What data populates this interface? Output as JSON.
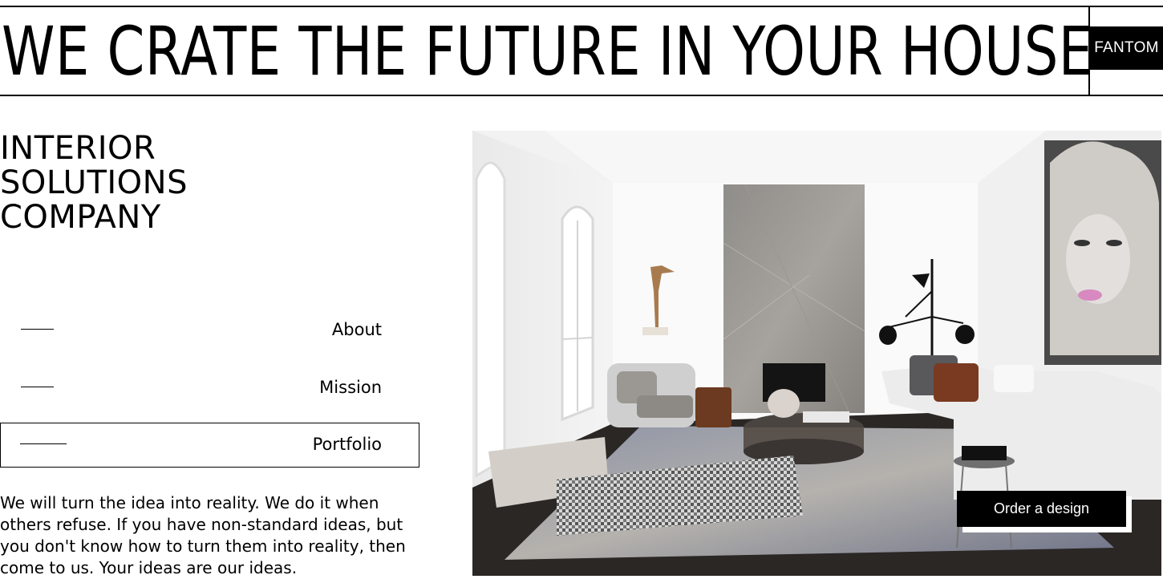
{
  "header": {
    "headline": "WE CRATE THE FUTURE IN YOUR HOUSE",
    "brand": "FANTOM"
  },
  "company": {
    "lines": [
      "INTERIOR",
      "SOLUTIONS",
      "COMPANY"
    ]
  },
  "nav": {
    "items": [
      {
        "label": "About",
        "active": false
      },
      {
        "label": "Mission",
        "active": false
      },
      {
        "label": "Portfolio",
        "active": true
      }
    ]
  },
  "description": "We will turn the idea into reality. We do it when others refuse. If you have non-standard ideas, but you don't know how to turn them into reality, then come to us. Your ideas are our ideas.",
  "hero": {
    "image_icon": "living-room-photo",
    "order_button": "Order a design"
  },
  "colors": {
    "primary": "#000000",
    "background": "#ffffff"
  }
}
